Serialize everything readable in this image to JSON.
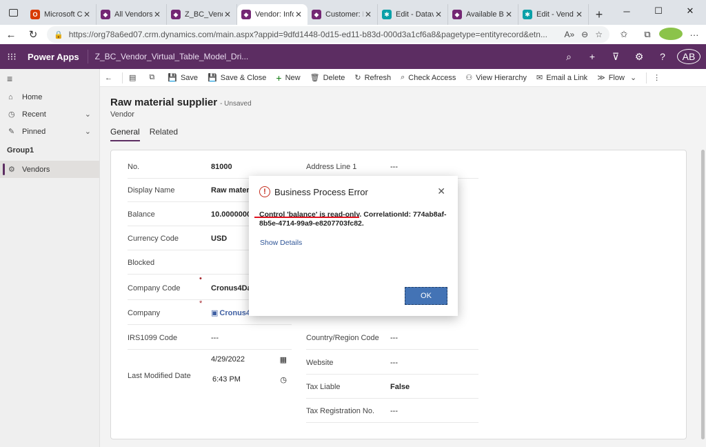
{
  "browser": {
    "tabs": [
      {
        "title": "Microsoft C",
        "fav_color": "#d83b01",
        "fav_glyph": "O"
      },
      {
        "title": "All Vendors",
        "fav_color": "#742774",
        "fav_glyph": "◆"
      },
      {
        "title": "Z_BC_Vend",
        "fav_color": "#742774",
        "fav_glyph": "◆"
      },
      {
        "title": "Vendor: Info",
        "fav_color": "#742774",
        "fav_glyph": "◆"
      },
      {
        "title": "Customer: I",
        "fav_color": "#742774",
        "fav_glyph": "◆"
      },
      {
        "title": "Edit - Datav",
        "fav_color": "#0aa0a8",
        "fav_glyph": "✱"
      },
      {
        "title": "Available B",
        "fav_color": "#742774",
        "fav_glyph": "◆"
      },
      {
        "title": "Edit - Vend",
        "fav_color": "#0aa0a8",
        "fav_glyph": "✱"
      }
    ],
    "active_tab_index": 3,
    "url": "https://org78a6ed07.crm.dynamics.com/main.aspx?appid=9dfd1448-0d15-ed11-b83d-000d3a1cf6a8&pagetype=entityrecord&etn..."
  },
  "app": {
    "name": "Power Apps",
    "environment": "Z_BC_Vendor_Virtual_Table_Model_Dri...",
    "avatar": "AB",
    "brand_color": "#5c2d62"
  },
  "sidebar": {
    "home": "Home",
    "recent": "Recent",
    "pinned": "Pinned",
    "group": "Group1",
    "vendors": "Vendors"
  },
  "commands": {
    "save": "Save",
    "save_close": "Save & Close",
    "new": "New",
    "delete": "Delete",
    "refresh": "Refresh",
    "check_access": "Check Access",
    "view_hierarchy": "View Hierarchy",
    "email_link": "Email a Link",
    "flow": "Flow"
  },
  "record": {
    "title": "Raw material supplier",
    "status": "- Unsaved",
    "entity": "Vendor",
    "tabs": [
      "General",
      "Related"
    ]
  },
  "fields_left": [
    {
      "label": "No.",
      "value": "81000",
      "bold": true
    },
    {
      "label": "Display Name",
      "value": "Raw materia",
      "bold": true
    },
    {
      "label": "Balance",
      "value": "10.00000000",
      "bold": true
    },
    {
      "label": "Currency Code",
      "value": "USD",
      "bold": true
    },
    {
      "label": "Blocked",
      "value": "",
      "bold": false
    },
    {
      "label": "Company Code",
      "value": "Cronus4Data",
      "bold": true,
      "req": "•"
    },
    {
      "label": "Company",
      "value": "Cronus4",
      "bold": true,
      "req": "*",
      "link": true
    },
    {
      "label": "IRS1099 Code",
      "value": "---",
      "bold": false
    },
    {
      "label": "Last Modified Date",
      "date": "4/29/2022",
      "time": "6:43 PM"
    }
  ],
  "fields_right": [
    {
      "label": "Address Line 1",
      "value": "---"
    },
    {
      "label": "Country/Region Code",
      "value": "---"
    },
    {
      "label": "Website",
      "value": "---"
    },
    {
      "label": "Tax Liable",
      "value": "False",
      "bold": true
    },
    {
      "label": "Tax Registration No.",
      "value": "---"
    }
  ],
  "dialog": {
    "title": "Business Process Error",
    "message": "Control 'balance' is read-only. CorrelationId: 774ab8af-8b5e-4714-99a9-e8207703fc82.",
    "details_link": "Show Details",
    "ok": "OK",
    "error_color": "#c42b1c",
    "ok_color": "#4373b5"
  }
}
